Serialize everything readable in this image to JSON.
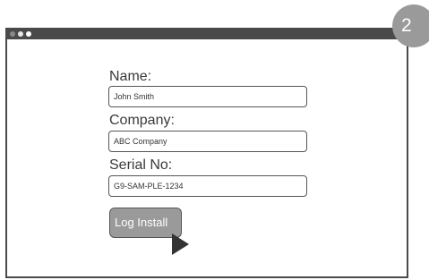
{
  "window": {
    "step_number": "2"
  },
  "form": {
    "name_label": "Name:",
    "name_value": "John Smith",
    "company_label": "Company:",
    "company_value": "ABC Company",
    "serial_label": "Serial No:",
    "serial_value": "G9-SAM-PLE-1234",
    "submit_label": "Log Install"
  },
  "icons": {
    "cursor": "mouse-pointer-icon"
  },
  "colors": {
    "frame": "#4a4a4a",
    "button": "#9a9a9a",
    "badge": "#9a9a9a"
  }
}
